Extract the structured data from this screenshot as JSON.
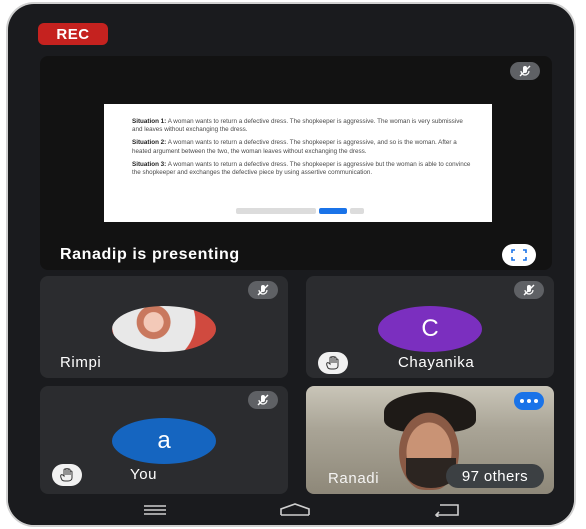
{
  "recording": {
    "label": "REC"
  },
  "presentation": {
    "caption": "Ranadip is presenting",
    "slide": [
      {
        "title": "Situation 1:",
        "text": "A woman wants to return a defective dress. The shopkeeper is aggressive. The woman is very submissive and leaves without exchanging the dress."
      },
      {
        "title": "Situation 2:",
        "text": "A woman wants to return a defective dress. The shopkeeper is aggressive, and so is the woman. After a heated argument between the two, the woman leaves without exchanging the dress."
      },
      {
        "title": "Situation 3:",
        "text": "A woman wants to return a defective dress. The shopkeeper is aggressive but the woman is able to convince the shopkeeper and exchanges the defective piece by using assertive communication."
      }
    ]
  },
  "participants": {
    "rimpi": {
      "name": "Rimpi"
    },
    "chayanika": {
      "name": "Chayanika",
      "initial": "C",
      "color": "#7b2fbf"
    },
    "you": {
      "name": "You",
      "initial": "a",
      "color": "#1565c0"
    },
    "ranadip": {
      "name": "Ranadi",
      "others": "97 others"
    }
  },
  "icons": {
    "mic_off": "mic-off-icon",
    "hand": "raised-hand-icon",
    "fullscreen": "fullscreen-icon",
    "more": "more-options-icon"
  }
}
